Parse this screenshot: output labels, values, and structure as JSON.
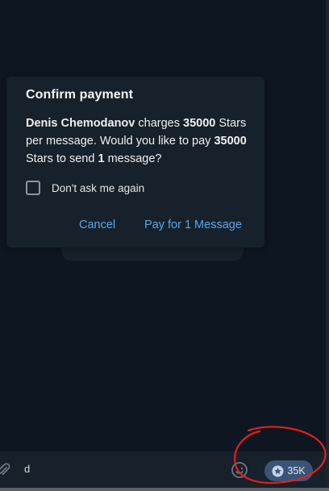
{
  "dialog": {
    "title": "Confirm payment",
    "body": {
      "name": "Denis Chemodanov",
      "t1": " charges ",
      "amount1": "35000",
      "t2": " Stars per message. Would you like to pay ",
      "amount2": "35000",
      "t3": " Stars to send ",
      "count": "1",
      "t4": " message?"
    },
    "checkbox_label": "Don't ask me again",
    "checkbox_checked": false,
    "cancel_label": "Cancel",
    "pay_label": "Pay for 1 Message"
  },
  "input_bar": {
    "message_text": "d",
    "attach_icon": "paperclip-icon",
    "emoji_icon": "emoji-icon",
    "stars_label": "35K",
    "stars_icon": "star-icon"
  },
  "colors": {
    "background": "#0e1621",
    "dialog": "#17212b",
    "accent": "#5aa7e6",
    "stars_pill": "#3a5476",
    "annotation": "#e0201f"
  }
}
